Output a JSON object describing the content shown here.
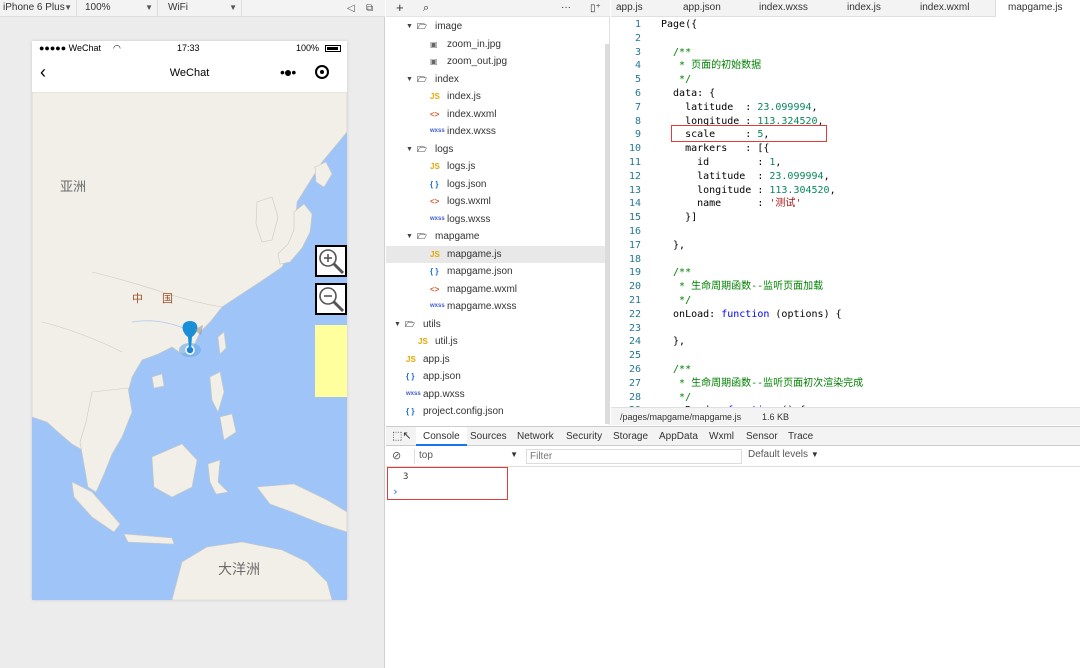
{
  "simulator": {
    "device": "iPhone 6 Plus",
    "zoom": "100%",
    "network": "WiFi",
    "status": {
      "carrier": "●●●●● WeChat",
      "time": "17:33",
      "battery": "100%"
    },
    "nav_title": "WeChat",
    "map": {
      "labels": {
        "asia": "亚洲",
        "china_1": "中",
        "china_2": "国",
        "oceania": "大洋洲"
      },
      "zoom_in_icon": "zoom-in-icon",
      "zoom_out_icon": "zoom-out-icon"
    }
  },
  "file_tree": [
    {
      "name": "image",
      "type": "folder",
      "depth": 1
    },
    {
      "name": "zoom_in.jpg",
      "type": "img",
      "depth": 2
    },
    {
      "name": "zoom_out.jpg",
      "type": "img",
      "depth": 2
    },
    {
      "name": "index",
      "type": "folder",
      "depth": 1
    },
    {
      "name": "index.js",
      "type": "js",
      "depth": 2
    },
    {
      "name": "index.wxml",
      "type": "wxml",
      "depth": 2
    },
    {
      "name": "index.wxss",
      "type": "wxss",
      "depth": 2
    },
    {
      "name": "logs",
      "type": "folder",
      "depth": 1
    },
    {
      "name": "logs.js",
      "type": "js",
      "depth": 2
    },
    {
      "name": "logs.json",
      "type": "json",
      "depth": 2
    },
    {
      "name": "logs.wxml",
      "type": "wxml",
      "depth": 2
    },
    {
      "name": "logs.wxss",
      "type": "wxss",
      "depth": 2
    },
    {
      "name": "mapgame",
      "type": "folder",
      "depth": 1
    },
    {
      "name": "mapgame.js",
      "type": "js",
      "depth": 2,
      "active": true
    },
    {
      "name": "mapgame.json",
      "type": "json",
      "depth": 2
    },
    {
      "name": "mapgame.wxml",
      "type": "wxml",
      "depth": 2
    },
    {
      "name": "mapgame.wxss",
      "type": "wxss",
      "depth": 2
    },
    {
      "name": "utils",
      "type": "folder",
      "depth": 0
    },
    {
      "name": "util.js",
      "type": "js",
      "depth": 1
    },
    {
      "name": "app.js",
      "type": "js",
      "depth": 0
    },
    {
      "name": "app.json",
      "type": "json",
      "depth": 0
    },
    {
      "name": "app.wxss",
      "type": "wxss",
      "depth": 0
    },
    {
      "name": "project.config.json",
      "type": "json",
      "depth": 0
    }
  ],
  "editor": {
    "tabs": [
      "app.js",
      "app.json",
      "index.wxss",
      "index.js",
      "index.wxml",
      "mapgame.js"
    ],
    "active_tab": "mapgame.js",
    "lines": [
      [
        [
          "",
          "Page({"
        ]
      ],
      [],
      [
        [
          "cm",
          "  /**"
        ]
      ],
      [
        [
          "cm",
          "   * 页面的初始数据"
        ]
      ],
      [
        [
          "cm",
          "   */"
        ]
      ],
      [
        [
          "",
          "  data: {"
        ]
      ],
      [
        [
          "",
          "    latitude  : "
        ],
        [
          "num",
          "23.099994"
        ],
        [
          "",
          ","
        ]
      ],
      [
        [
          "",
          "    longitude : "
        ],
        [
          "num",
          "113.324520"
        ],
        [
          "",
          ","
        ]
      ],
      [
        [
          "",
          "    scale     : "
        ],
        [
          "num",
          "5"
        ],
        [
          "",
          ","
        ]
      ],
      [
        [
          "",
          "    markers   : [{"
        ]
      ],
      [
        [
          "",
          "      id        : "
        ],
        [
          "num",
          "1"
        ],
        [
          "",
          ","
        ]
      ],
      [
        [
          "",
          "      latitude  : "
        ],
        [
          "num",
          "23.099994"
        ],
        [
          "",
          ","
        ]
      ],
      [
        [
          "",
          "      longitude : "
        ],
        [
          "num",
          "113.304520"
        ],
        [
          "",
          ","
        ]
      ],
      [
        [
          "",
          "      name      : "
        ],
        [
          "str",
          "'测试'"
        ]
      ],
      [
        [
          "",
          "    }]"
        ]
      ],
      [],
      [
        [
          "",
          "  },"
        ]
      ],
      [],
      [
        [
          "cm",
          "  /**"
        ]
      ],
      [
        [
          "cm",
          "   * 生命周期函数--监听页面加载"
        ]
      ],
      [
        [
          "cm",
          "   */"
        ]
      ],
      [
        [
          "",
          "  onLoad: "
        ],
        [
          "kw",
          "function"
        ],
        [
          "",
          " (options) {"
        ]
      ],
      [],
      [
        [
          "",
          "  },"
        ]
      ],
      [],
      [
        [
          "cm",
          "  /**"
        ]
      ],
      [
        [
          "cm",
          "   * 生命周期函数--监听页面初次渲染完成"
        ]
      ],
      [
        [
          "cm",
          "   */"
        ]
      ],
      [
        [
          "",
          "  onReady: "
        ],
        [
          "kw",
          "function"
        ],
        [
          "",
          " () {"
        ]
      ]
    ],
    "status_path": "/pages/mapgame/mapgame.js",
    "status_size": "1.6 KB"
  },
  "devtools": {
    "tabs": [
      "Console",
      "Sources",
      "Network",
      "Security",
      "Storage",
      "AppData",
      "Wxml",
      "Sensor",
      "Trace"
    ],
    "active_tab": "Console",
    "context": "top",
    "filter_placeholder": "Filter",
    "levels": "Default levels",
    "output": [
      "3"
    ],
    "prompt": "›"
  }
}
